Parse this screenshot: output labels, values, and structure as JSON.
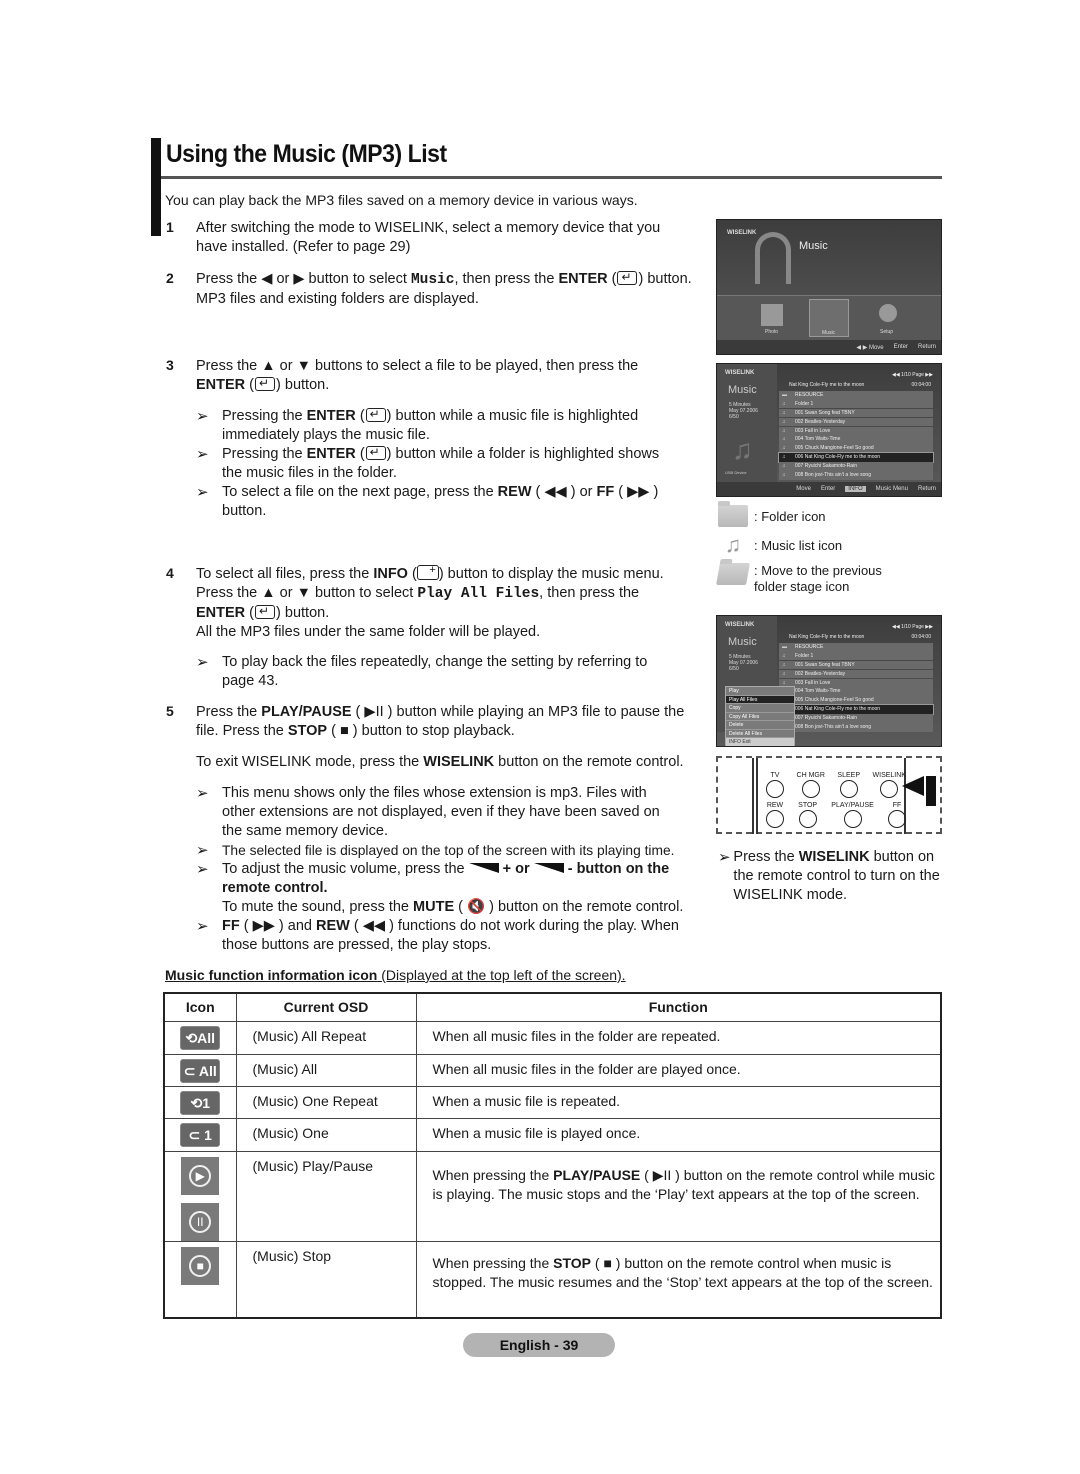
{
  "page": {
    "title": "Using the Music (MP3) List",
    "intro": "You can play back the MP3 files saved on a memory device in various ways.",
    "footer": "English - 39"
  },
  "steps": [
    {
      "num": "1",
      "text": "After switching the mode to WISELINK, select a memory device that you have installed. (Refer to page 29)"
    },
    {
      "num": "2",
      "pre": "Press the ◀ or ▶ button to select ",
      "code": "Music",
      "mid": ", then press the ",
      "bold": "ENTER",
      "post": " button. MP3 files and existing folders are displayed."
    },
    {
      "num": "3",
      "pre": "Press the ▲ or ▼ buttons to select a file to be played, then press the ",
      "bold": "ENTER",
      "post": " button.",
      "notes": [
        {
          "pre": "Pressing the ",
          "bold": "ENTER",
          "post": " button while a music file is highlighted immediately plays the music file."
        },
        {
          "pre": "Pressing the ",
          "bold": "ENTER",
          "post": " button while a folder is highlighted shows the music files in the folder."
        },
        {
          "pre": "To select a file on the next page, press the ",
          "bold": "REW",
          "mid": " ( ◀◀ ) or ",
          "bold2": "FF",
          "post": " ( ▶▶ ) button."
        }
      ]
    },
    {
      "num": "4",
      "pre": "To select all files, press the ",
      "bold": "INFO",
      "mid": " button to display the music menu. Press the ▲ or ▼ button to select ",
      "code": "Play All Files",
      "mid2": ", then press the ",
      "bold2": "ENTER",
      "post": " button.",
      "line2": "All the MP3 files under the same folder will be played.",
      "notes": [
        {
          "text": "To play back the files repeatedly, change the setting by referring to page 43."
        }
      ]
    },
    {
      "num": "5",
      "pre": "Press the ",
      "bold": "PLAY/PAUSE",
      "mid": " ( ▶II ) button while playing an MP3 file to pause the file. Press the ",
      "bold2": "STOP",
      "post": " ( ■ ) button to stop playback.",
      "exit_pre": "To exit WISELINK mode, press the ",
      "exit_bold": "WISELINK",
      "exit_post": " button on the remote control.",
      "notes": [
        {
          "text": "This menu shows only the files whose extension is mp3. Files with other extensions are not displayed, even if they have been saved on the same memory device."
        },
        {
          "text": "The selected file is displayed on the top of the screen with its playing time."
        },
        {
          "pre": "To adjust the music volume, press the ",
          "mid": " + or ",
          "post": " - button on the remote control.",
          "mute_pre": "To mute the sound, press the ",
          "mute_bold": "MUTE",
          "mute_post": " ( 🔇 ) button on the remote control."
        },
        {
          "bold": "FF",
          "mid": " ( ▶▶ ) and ",
          "bold2": "REW",
          "post": " ( ◀◀ ) functions do not work during the play. When those buttons are pressed, the play stops."
        }
      ]
    }
  ],
  "screens": {
    "home": {
      "logo": "WISELINK",
      "heading": "Music",
      "items": [
        "Photo",
        "Music",
        "Setup"
      ],
      "footer": [
        "◀ ▶ Move",
        "Enter",
        "Return"
      ]
    },
    "list": {
      "logo": "WISELINK",
      "side_label": "Music",
      "side_meta": "5 Minutes\nMay 07.2006\n6/50",
      "device": "USB Device",
      "page": "◀◀ 1/10 Page ▶▶",
      "now_playing": "Nat King Cole-Fly me to the moon",
      "time": "00:04:00",
      "rows": [
        {
          "label": "RESOURCE",
          "type": "folder"
        },
        {
          "label": "Folder 1",
          "type": "music"
        },
        {
          "label": "001  Swan Song feat TBNY",
          "type": "music"
        },
        {
          "label": "002  Beatles-Yesterday",
          "type": "music"
        },
        {
          "label": "003  Fall in Love",
          "type": "music"
        },
        {
          "label": "004  Tom Waits-Time",
          "type": "music"
        },
        {
          "label": "005  Chuck Mangione-Feel So good",
          "type": "music"
        },
        {
          "label": "006  Nat King Cole-Fly me to the moon",
          "type": "play",
          "selected": true
        },
        {
          "label": "007  Ryuichi Sakamoto-Rain",
          "type": "music"
        },
        {
          "label": "008  Bon jovi-This ain't a love song",
          "type": "music"
        }
      ],
      "footer": [
        "Move",
        "Enter",
        "INFO",
        "Music Menu",
        "Return"
      ]
    },
    "menu": {
      "items": [
        "Play",
        "Play All Files",
        "Copy",
        "Copy All Files",
        "Delete",
        "Delete All Files"
      ],
      "selected": "Play All Files",
      "exit_key": "INFO",
      "exit": "Exit"
    }
  },
  "legend": [
    {
      "icon": "folder-icon",
      "text": ": Folder icon"
    },
    {
      "icon": "music-list-icon",
      "text": ": Music list icon"
    },
    {
      "icon": "previous-folder-icon",
      "text": ": Move to the previous folder stage icon"
    }
  ],
  "remote": {
    "row1": [
      "TV",
      "CH MGR",
      "SLEEP",
      "WISELINK"
    ],
    "row2": [
      "REW",
      "STOP",
      "PLAY/PAUSE",
      "FF"
    ]
  },
  "side_note": {
    "pre": "Press the ",
    "bold": "WISELINK",
    "post": " button on the remote control to turn on the WISELINK mode."
  },
  "table_caption": {
    "bold": "Music function information icon",
    "rest": " (Displayed at the top left of the screen)."
  },
  "table": {
    "headers": [
      "Icon",
      "Current OSD",
      "Function"
    ],
    "rows": [
      {
        "icon": "⟲All",
        "osd": "(Music) All Repeat",
        "func": "When all music files in the folder are repeated."
      },
      {
        "icon": "⊂ All",
        "osd": "(Music) All",
        "func": "When all music files in the folder are played once."
      },
      {
        "icon": "⟲1",
        "osd": "(Music) One Repeat",
        "func": "When a music file is repeated."
      },
      {
        "icon": "⊂ 1",
        "osd": "(Music) One",
        "func": "When a music file is played once."
      },
      {
        "icon": "play-pause",
        "osd": "(Music) Play/Pause",
        "func_pre": "When pressing the ",
        "func_bold": "PLAY/PAUSE",
        "func_post": " ( ▶II ) button on the remote control while music is playing. The music stops and the ‘Play’ text appears at the top of the screen."
      },
      {
        "icon": "stop",
        "osd": "(Music) Stop",
        "func_pre": "When pressing the ",
        "func_bold": "STOP",
        "func_post": " ( ■ ) button on the remote control when music is stopped. The music resumes and the ‘Stop’ text appears at the top of the screen."
      }
    ]
  }
}
